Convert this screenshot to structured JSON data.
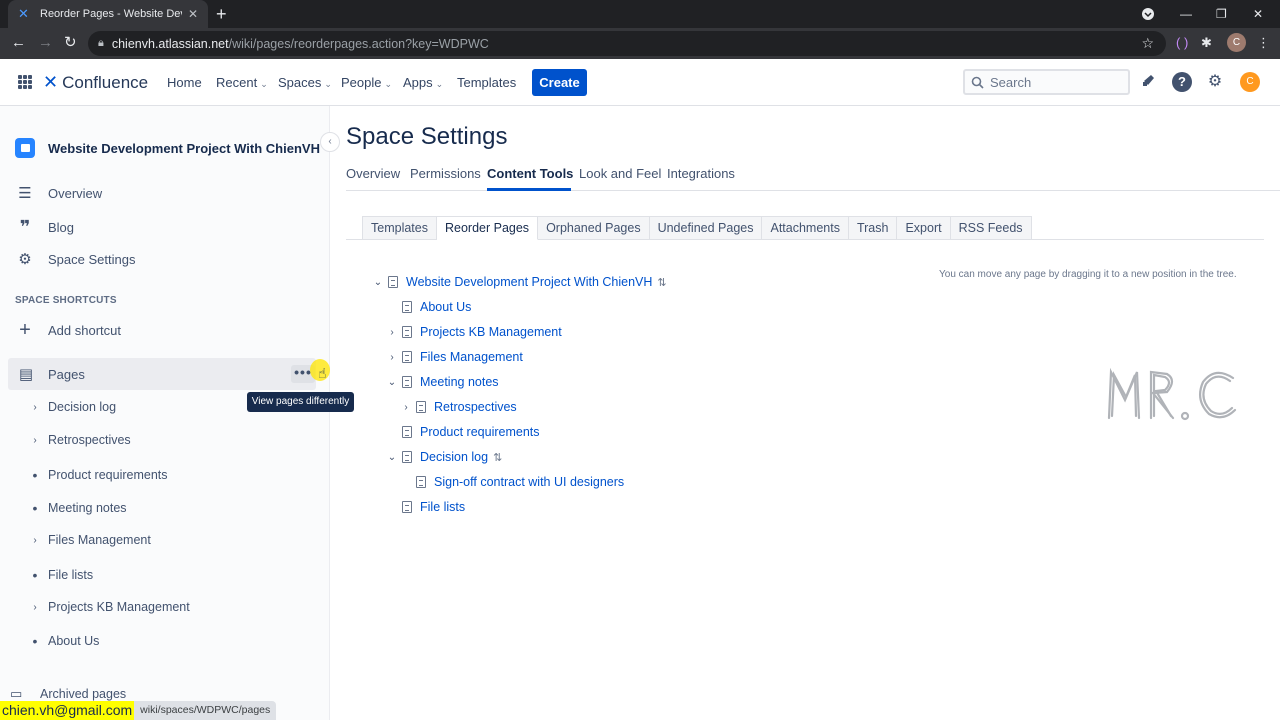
{
  "browser": {
    "tab_title": "Reorder Pages - Website Develop",
    "url_domain": "chienvh.atlassian.net",
    "url_path": "/wiki/pages/reorderpages.action?key=WDPWC",
    "profile_initial": "C"
  },
  "topnav": {
    "product": "Confluence",
    "items": [
      {
        "label": "Home",
        "dropdown": false
      },
      {
        "label": "Recent",
        "dropdown": true
      },
      {
        "label": "Spaces",
        "dropdown": true
      },
      {
        "label": "People",
        "dropdown": true
      },
      {
        "label": "Apps",
        "dropdown": true
      },
      {
        "label": "Templates",
        "dropdown": false
      }
    ],
    "create_label": "Create",
    "search_placeholder": "Search",
    "avatar_initial": "C"
  },
  "sidebar": {
    "space_name": "Website Development Project With ChienVH",
    "nav": [
      {
        "label": "Overview",
        "icon": "overview-icon"
      },
      {
        "label": "Blog",
        "icon": "quote-icon"
      },
      {
        "label": "Space Settings",
        "icon": "gear-icon"
      }
    ],
    "shortcuts_heading": "SPACE SHORTCUTS",
    "add_shortcut": "Add shortcut",
    "pages_label": "Pages",
    "tooltip": "View pages differently",
    "tree": [
      {
        "label": "Decision log",
        "expandable": true
      },
      {
        "label": "Retrospectives",
        "expandable": true
      },
      {
        "label": "Product requirements",
        "expandable": false
      },
      {
        "label": "Meeting notes",
        "expandable": false
      },
      {
        "label": "Files Management",
        "expandable": true
      },
      {
        "label": "File lists",
        "expandable": false
      },
      {
        "label": "Projects KB Management",
        "expandable": true
      },
      {
        "label": "About Us",
        "expandable": false
      }
    ],
    "archived": "Archived pages"
  },
  "main": {
    "title": "Space Settings",
    "tabs": [
      "Overview",
      "Permissions",
      "Content Tools",
      "Look and Feel",
      "Integrations"
    ],
    "active_tab": "Content Tools",
    "subtabs": [
      "Templates",
      "Reorder Pages",
      "Orphaned Pages",
      "Undefined Pages",
      "Attachments",
      "Trash",
      "Export",
      "RSS Feeds"
    ],
    "active_subtab": "Reorder Pages",
    "hint": "You can move any page by dragging it to a new position in the tree.",
    "tree": [
      {
        "label": "Website Development Project With ChienVH",
        "toggle": "collapse",
        "sortable": true,
        "level": 0
      },
      {
        "label": "About Us",
        "toggle": "none",
        "sortable": false,
        "level": 1
      },
      {
        "label": "Projects KB Management",
        "toggle": "expand",
        "sortable": false,
        "level": 1
      },
      {
        "label": "Files Management",
        "toggle": "expand",
        "sortable": false,
        "level": 1
      },
      {
        "label": "Meeting notes",
        "toggle": "collapse",
        "sortable": false,
        "level": 1
      },
      {
        "label": "Retrospectives",
        "toggle": "expand",
        "sortable": false,
        "level": 2
      },
      {
        "label": "Product requirements",
        "toggle": "none",
        "sortable": false,
        "level": 1
      },
      {
        "label": "Decision log",
        "toggle": "collapse",
        "sortable": true,
        "level": 1
      },
      {
        "label": "Sign-off contract with UI designers",
        "toggle": "none",
        "sortable": false,
        "level": 2
      },
      {
        "label": "File lists",
        "toggle": "none",
        "sortable": false,
        "level": 1
      }
    ]
  },
  "statusbar": {
    "email": "chien.vh@gmail.com",
    "url": "wiki/spaces/WDPWC/pages"
  },
  "colors": {
    "brand": "#0052cc",
    "link": "#0052cc",
    "sidebar_bg": "#fafbfc",
    "browser_dark": "#202124"
  }
}
